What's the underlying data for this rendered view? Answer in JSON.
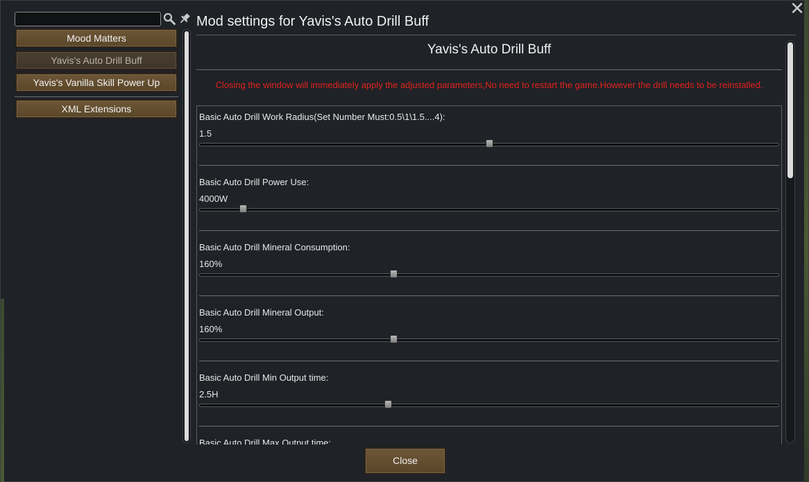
{
  "window": {
    "title": "Mod settings for Yavis's Auto Drill Buff",
    "close_icon": "close-x-icon"
  },
  "sidebar": {
    "search": {
      "value": "",
      "placeholder": ""
    },
    "items": [
      {
        "label": "Mood Matters",
        "active": false
      },
      {
        "label": "Yavis's Auto Drill Buff",
        "active": true
      },
      {
        "label": "Yavis's Vanilla Skill Power Up",
        "active": false
      },
      {
        "label": "XML Extensions",
        "active": false
      }
    ]
  },
  "main": {
    "heading": "Yavis's Auto Drill Buff",
    "notice": "Closing the window will immediately apply the adjusted parameters,No need to restart the game.However the drill needs to be reinstalled.",
    "notice_color": "#e0231c",
    "settings": [
      {
        "label": "Basic Auto Drill Work Radius(Set Number Must:0.5\\1\\1.5....4):",
        "value": "1.5",
        "slider_fraction": 0.5
      },
      {
        "label": "Basic Auto Drill Power Use:",
        "value": "4000W",
        "slider_fraction": 0.076
      },
      {
        "label": "Basic Auto Drill Mineral Consumption:",
        "value": "160%",
        "slider_fraction": 0.336
      },
      {
        "label": "Basic Auto Drill Mineral Output:",
        "value": "160%",
        "slider_fraction": 0.336
      },
      {
        "label": "Basic Auto Drill Min Output time:",
        "value": "2.5H",
        "slider_fraction": 0.326
      },
      {
        "label": "Basic Auto Drill Max Output time:",
        "value": "",
        "slider_fraction": null
      }
    ]
  },
  "footer": {
    "close_label": "Close"
  },
  "colors": {
    "button_brown": "#6d5636",
    "background": "#1f2227",
    "accent_red": "#e0231c"
  }
}
